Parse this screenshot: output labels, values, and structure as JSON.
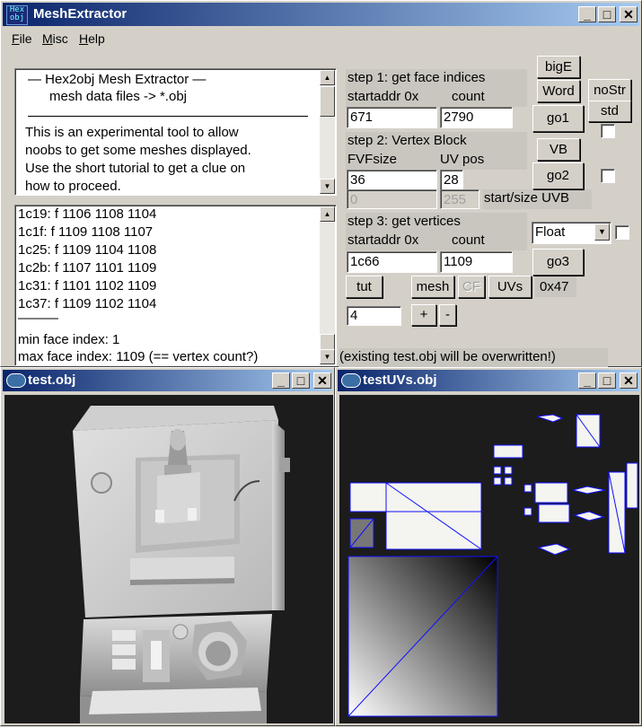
{
  "main_window": {
    "title": "MeshExtractor",
    "icon_text": "Hex obj",
    "menu": [
      {
        "label": "File",
        "accel": "F",
        "rest": "ile"
      },
      {
        "label": "Misc",
        "accel": "M",
        "rest": "isc"
      },
      {
        "label": "Help",
        "accel": "H",
        "rest": "elp"
      }
    ],
    "info": {
      "line1": "—   Hex2obj Mesh Extractor   —",
      "line2": "mesh data files -> *.obj",
      "para": [
        "This is an experimental tool to allow",
        "noobs to get some meshes displayed.",
        "Use the short tutorial to get a clue on",
        "how to proceed."
      ]
    },
    "log": {
      "lines": [
        "1c19: f  1106 1108 1104",
        "1c1f: f  1109 1108 1107",
        "1c25: f  1109 1104 1108",
        "1c2b: f  1107 1101 1109",
        "1c31: f  1101 1102 1109",
        "1c37: f  1109 1102 1104",
        "———",
        "min face index: 1",
        "max face index: 1109 (== vertex count?)"
      ]
    },
    "step1": {
      "title": "step 1: get face indices",
      "addr_label": "startaddr 0x",
      "count_label": "count",
      "addr_value": "671",
      "count_value": "2790"
    },
    "step2": {
      "title": "step 2: Vertex Block",
      "fvf_label": "FVFsize",
      "uv_label": "UV pos",
      "fvf_value": "36",
      "uv_value": "28",
      "start_value": "0",
      "size_value": "255",
      "uvb_label": "start/size UVB"
    },
    "step3": {
      "title": "step 3: get vertices",
      "addr_label": "startaddr 0x",
      "count_label": "count",
      "addr_value": "1c66",
      "count_value": "1109",
      "format_value": "Float"
    },
    "buttons": {
      "bigE": "bigE",
      "word": "Word",
      "noStr": "noStr",
      "std": "std",
      "go1": "go1",
      "vb": "VB",
      "go2": "go2",
      "go3": "go3",
      "tut": "tut",
      "mesh": "mesh",
      "cf": "CF",
      "uvs": "UVs",
      "plus": "+",
      "minus": "-"
    },
    "hex_label": "0x47",
    "step_value": "4",
    "status": "(existing test.obj will be overwritten!)"
  },
  "mesh_window": {
    "title": "test.obj"
  },
  "uv_window": {
    "title": "testUVs.obj"
  }
}
